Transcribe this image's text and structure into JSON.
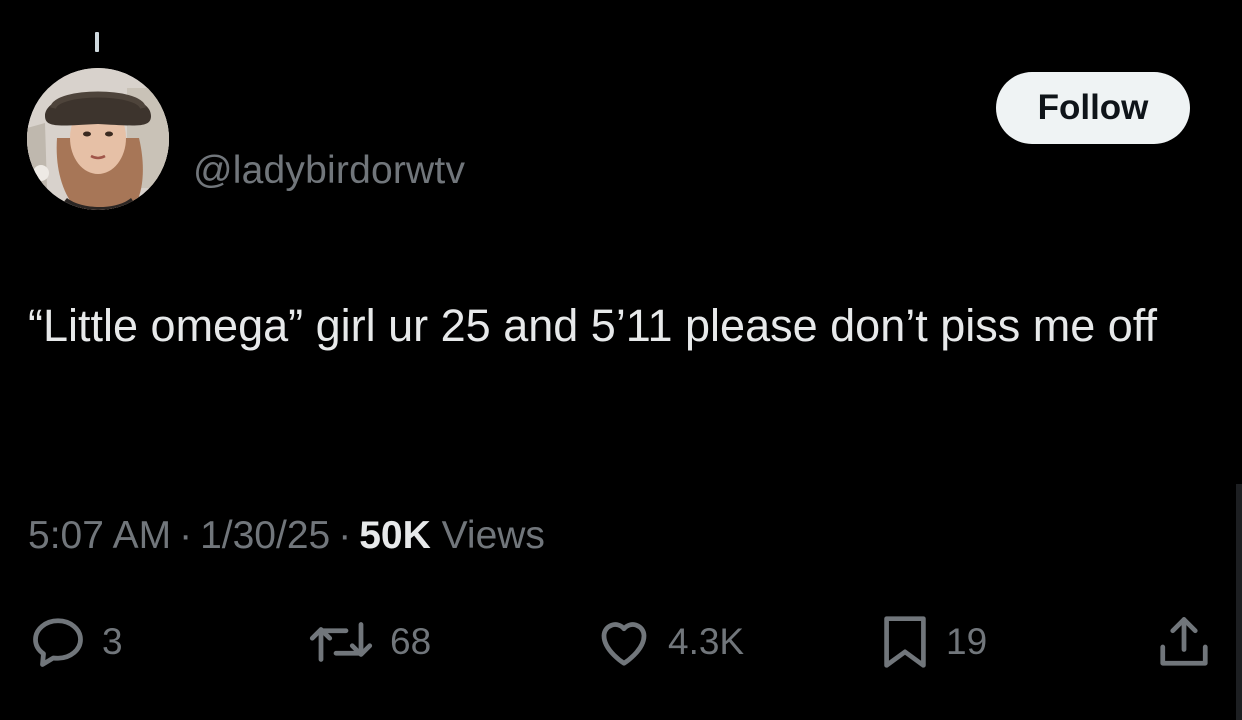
{
  "author": {
    "handle": "@ladybirdorwtv",
    "avatar_icon": "profile-photo"
  },
  "follow_button": {
    "label": "Follow"
  },
  "tweet": {
    "text": "“Little omega” girl ur 25 and 5’11 please don’t piss me off"
  },
  "meta": {
    "time": "5:07 AM",
    "separator": "·",
    "date": "1/30/25",
    "views_count": "50K",
    "views_label": "Views"
  },
  "actions": {
    "replies": {
      "icon": "reply-icon",
      "count": "3"
    },
    "reposts": {
      "icon": "retweet-icon",
      "count": "68"
    },
    "likes": {
      "icon": "heart-icon",
      "count": "4.3K"
    },
    "bookmarks": {
      "icon": "bookmark-icon",
      "count": "19"
    },
    "share": {
      "icon": "share-icon"
    }
  },
  "colors": {
    "background": "#000000",
    "primary_text": "#e7e9ea",
    "secondary_text": "#71767b",
    "follow_bg": "#eff3f4",
    "follow_text": "#0f1419"
  }
}
